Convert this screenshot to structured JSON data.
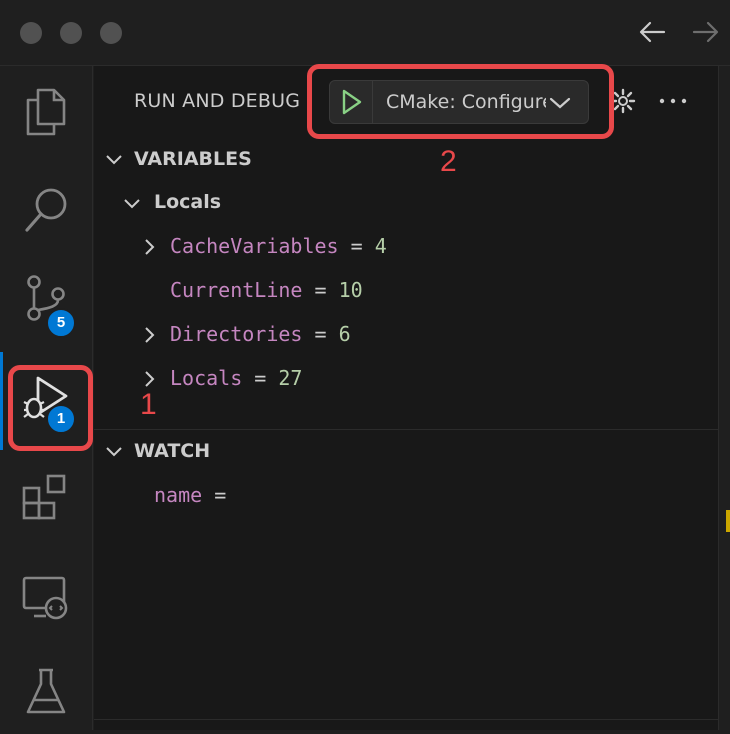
{
  "window": {
    "traffic_lights": [
      "close",
      "minimize",
      "zoom"
    ],
    "back_icon": "arrow-left-icon",
    "forward_icon": "arrow-right-icon"
  },
  "activity_bar": {
    "items": [
      {
        "name": "explorer",
        "icon": "files-icon"
      },
      {
        "name": "search",
        "icon": "search-icon"
      },
      {
        "name": "source-control",
        "icon": "source-control-icon",
        "badge": "5"
      },
      {
        "name": "run-and-debug",
        "icon": "run-debug-icon",
        "badge": "1",
        "active": true
      },
      {
        "name": "extensions",
        "icon": "extensions-icon"
      },
      {
        "name": "remote-explorer",
        "icon": "remote-explorer-icon"
      },
      {
        "name": "testing",
        "icon": "beaker-icon"
      }
    ]
  },
  "sidebar": {
    "title": "RUN AND DEBUG",
    "launch_config": "CMake: Configure",
    "sections": {
      "variables": {
        "title": "VARIABLES",
        "scope": "Locals",
        "items": [
          {
            "name": "CacheVariables",
            "eq": "=",
            "value": "4",
            "expandable": true
          },
          {
            "name": "CurrentLine",
            "eq": "=",
            "value": "10",
            "expandable": false
          },
          {
            "name": "Directories",
            "eq": "=",
            "value": "6",
            "expandable": true
          },
          {
            "name": "Locals",
            "eq": "=",
            "value": "27",
            "expandable": true
          }
        ]
      },
      "watch": {
        "title": "WATCH",
        "items": [
          {
            "name": "name",
            "eq": "="
          }
        ]
      }
    }
  },
  "annotations": {
    "callout_1": "1",
    "callout_2": "2",
    "color": "#e8484a"
  },
  "colors": {
    "accent": "#0078d4",
    "variable_name": "#c586c0",
    "variable_value": "#b5cea8",
    "play_green": "#89d185"
  }
}
